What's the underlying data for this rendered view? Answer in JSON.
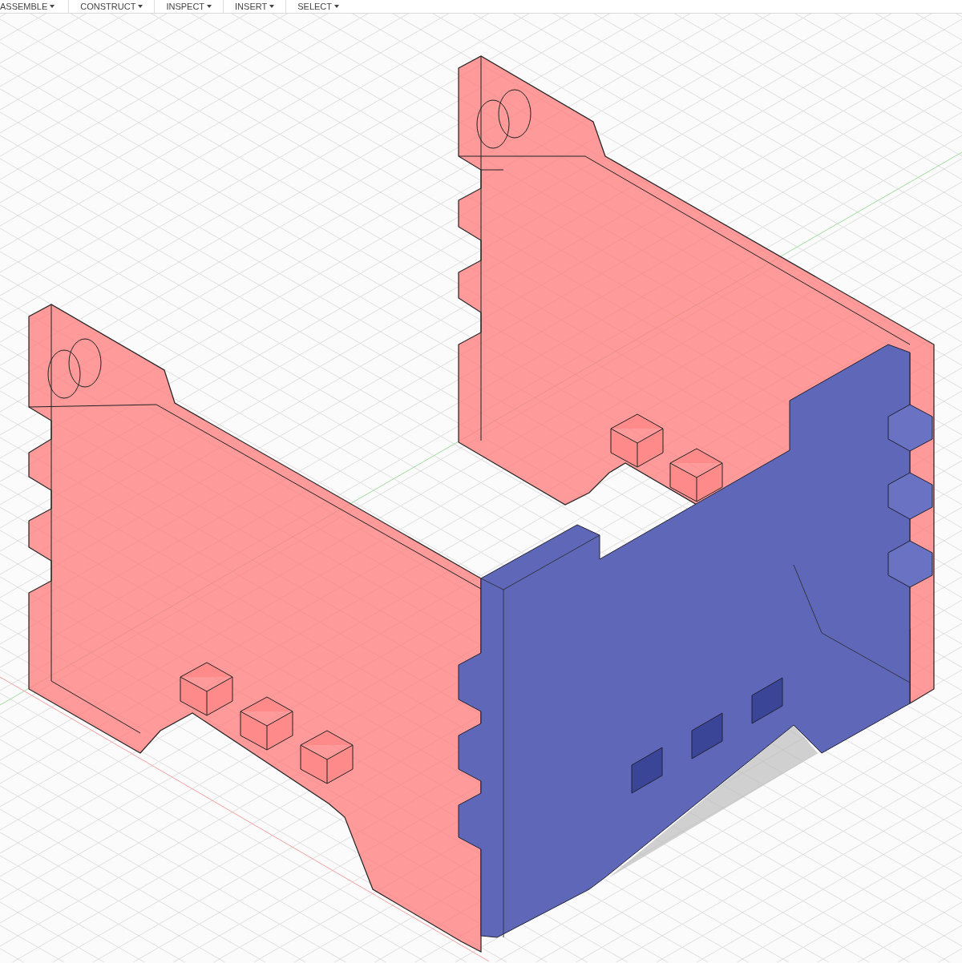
{
  "toolbar": {
    "menus": [
      {
        "label": "ASSEMBLE"
      },
      {
        "label": "CONSTRUCT"
      },
      {
        "label": "INSPECT"
      },
      {
        "label": "INSERT"
      },
      {
        "label": "SELECT"
      }
    ]
  }
}
